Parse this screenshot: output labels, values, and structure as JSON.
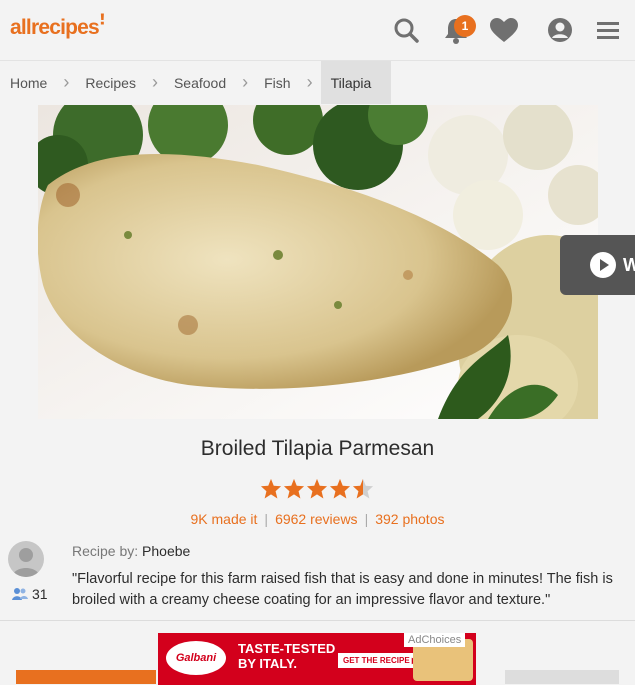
{
  "header": {
    "logo": "allrecipes",
    "notification_count": "1",
    "icons": [
      "search-icon",
      "bell-icon",
      "heart-icon",
      "user-icon",
      "menu-icon"
    ]
  },
  "breadcrumb": [
    "Home",
    "Recipes",
    "Seafood",
    "Fish",
    "Tilapia"
  ],
  "video": {
    "label": "W"
  },
  "recipe": {
    "title": "Broiled Tilapia Parmesan",
    "rating_stars": 4.5,
    "made_it": "9K made it",
    "reviews": "6962 reviews",
    "photos": "392 photos",
    "by_label": "Recipe by:",
    "author": "Phoebe",
    "followers": "31",
    "description": "\"Flavorful recipe for this farm raised fish that is easy and done in minutes! The fish is broiled with a creamy cheese coating for an impressive flavor and texture.\""
  },
  "ad": {
    "brand": "Galbani",
    "headline_1": "TASTE-TESTED",
    "headline_2": "BY ITALY.",
    "button": "GET THE RECIPE ▶",
    "adchoices": "AdChoices"
  },
  "colors": {
    "accent": "#e8701f",
    "ad_red": "#d3001c"
  }
}
